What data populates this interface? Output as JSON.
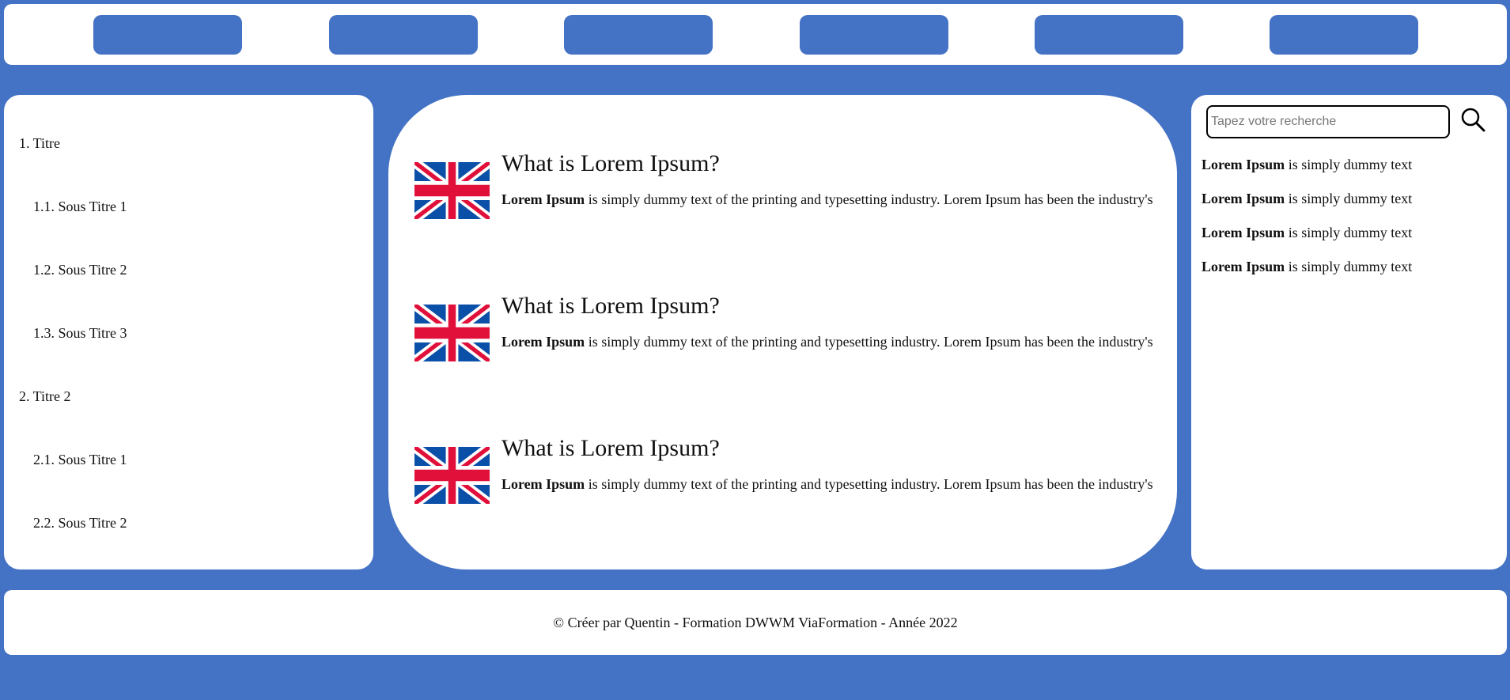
{
  "nav": {
    "buttons": [
      "",
      "",
      "",
      "",
      "",
      ""
    ]
  },
  "sidebar": {
    "items": [
      {
        "label": "1. Titre"
      },
      {
        "label": "1.1. Sous Titre 1"
      },
      {
        "label": "1.2. Sous Titre 2"
      },
      {
        "label": "1.3. Sous Titre 3"
      },
      {
        "label": "2. Titre 2"
      },
      {
        "label": "2.1. Sous Titre 1"
      },
      {
        "label": "2.2. Sous Titre 2"
      }
    ]
  },
  "articles": [
    {
      "title": "What is Lorem Ipsum?",
      "bold": "Lorem Ipsum",
      "text": " is simply dummy text of the printing and typesetting industry. Lorem Ipsum has been the industry's",
      "flag": "uk-flag-icon"
    },
    {
      "title": "What is Lorem Ipsum?",
      "bold": "Lorem Ipsum",
      "text": " is simply dummy text of the printing and typesetting industry. Lorem Ipsum has been the industry's",
      "flag": "uk-flag-icon"
    },
    {
      "title": "What is Lorem Ipsum?",
      "bold": "Lorem Ipsum",
      "text": " is simply dummy text of the printing and typesetting industry. Lorem Ipsum has been the industry's",
      "flag": "uk-flag-icon"
    }
  ],
  "search": {
    "placeholder": "Tapez votre recherche",
    "icon": "search-icon"
  },
  "side_list": [
    {
      "bold": "Lorem Ipsum",
      "text": " is simply dummy text"
    },
    {
      "bold": "Lorem Ipsum",
      "text": " is simply dummy text"
    },
    {
      "bold": "Lorem Ipsum",
      "text": " is simply dummy text"
    },
    {
      "bold": "Lorem Ipsum",
      "text": " is simply dummy text"
    }
  ],
  "footer": {
    "text": "© Créer par Quentin - Formation DWWM ViaFormation - Année 2022"
  },
  "colors": {
    "background": "#4472c4",
    "panel": "#ffffff",
    "nav_button": "#4472c4",
    "flag_blue": "#0a4fa8",
    "flag_red": "#e0103a"
  }
}
